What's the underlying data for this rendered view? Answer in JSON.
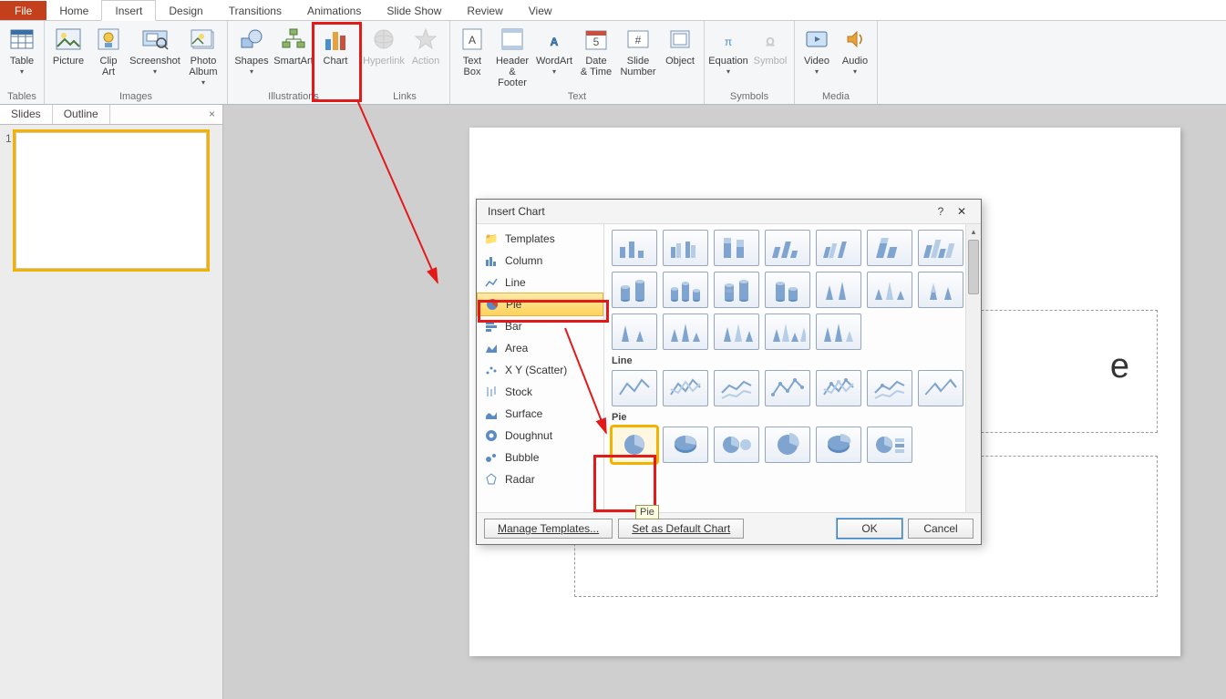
{
  "tabs": {
    "file": "File",
    "list": [
      "Home",
      "Insert",
      "Design",
      "Transitions",
      "Animations",
      "Slide Show",
      "Review",
      "View"
    ],
    "active": "Insert"
  },
  "ribbon": {
    "groups": {
      "tables": {
        "label": "Tables",
        "items": {
          "table": "Table"
        }
      },
      "images": {
        "label": "Images",
        "items": {
          "picture": "Picture",
          "clipart": "Clip\nArt",
          "screenshot": "Screenshot",
          "album": "Photo\nAlbum"
        }
      },
      "illus": {
        "label": "Illustrations",
        "items": {
          "shapes": "Shapes",
          "smartart": "SmartArt",
          "chart": "Chart"
        }
      },
      "links": {
        "label": "Links",
        "items": {
          "hyperlink": "Hyperlink",
          "action": "Action"
        }
      },
      "text": {
        "label": "Text",
        "items": {
          "textbox": "Text\nBox",
          "hf": "Header\n& Footer",
          "wordart": "WordArt",
          "dt": "Date\n& Time",
          "slidenum": "Slide\nNumber",
          "object": "Object"
        }
      },
      "symbols": {
        "label": "Symbols",
        "items": {
          "equation": "Equation",
          "symbol": "Symbol"
        }
      },
      "media": {
        "label": "Media",
        "items": {
          "video": "Video",
          "audio": "Audio"
        }
      }
    }
  },
  "panel": {
    "tabs": {
      "slides": "Slides",
      "outline": "Outline"
    },
    "slide_num": "1"
  },
  "slide": {
    "title_fragment": "e"
  },
  "dialog": {
    "title": "Insert Chart",
    "help": "?",
    "close": "✕",
    "categories": [
      "Templates",
      "Column",
      "Line",
      "Pie",
      "Bar",
      "Area",
      "X Y (Scatter)",
      "Stock",
      "Surface",
      "Doughnut",
      "Bubble",
      "Radar"
    ],
    "selected_cat": "Pie",
    "headers": {
      "line": "Line",
      "pie": "Pie"
    },
    "tooltip": "Pie",
    "buttons": {
      "manage": "Manage Templates...",
      "default": "Set as Default Chart",
      "ok": "OK",
      "cancel": "Cancel"
    }
  }
}
